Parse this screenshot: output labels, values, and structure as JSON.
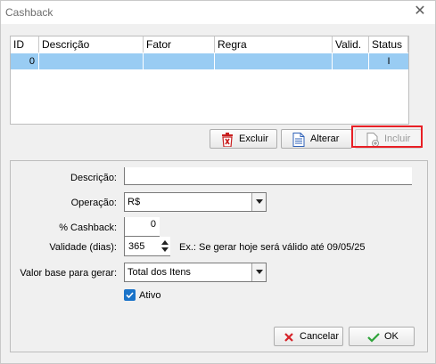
{
  "window": {
    "title": "Cashback"
  },
  "grid": {
    "columns": [
      "ID",
      "Descrição",
      "Fator",
      "Regra",
      "Valid.",
      "Status"
    ],
    "rows": [
      {
        "id": "0",
        "descricao": "",
        "fator": "",
        "regra": "",
        "valid": "",
        "status": "I"
      }
    ]
  },
  "actions": {
    "excluir": "Excluir",
    "alterar": "Alterar",
    "incluir": "Incluir"
  },
  "form": {
    "descricao_label": "Descrição:",
    "descricao_value": "",
    "operacao_label": "Operação:",
    "operacao_value": "R$",
    "cashback_label": "% Cashback:",
    "cashback_value": "0",
    "validade_label": "Validade (dias):",
    "validade_value": "365",
    "validade_hint": "Ex.: Se gerar hoje será válido até 09/05/25",
    "valor_base_label": "Valor base para gerar:",
    "valor_base_value": "Total dos Itens",
    "ativo_label": "Ativo",
    "ativo_checked": true
  },
  "footer": {
    "cancelar": "Cancelar",
    "ok": "OK"
  },
  "colors": {
    "highlight": "#e81f25",
    "selected_row": "#99ccf3",
    "checkbox": "#1a73c9"
  }
}
